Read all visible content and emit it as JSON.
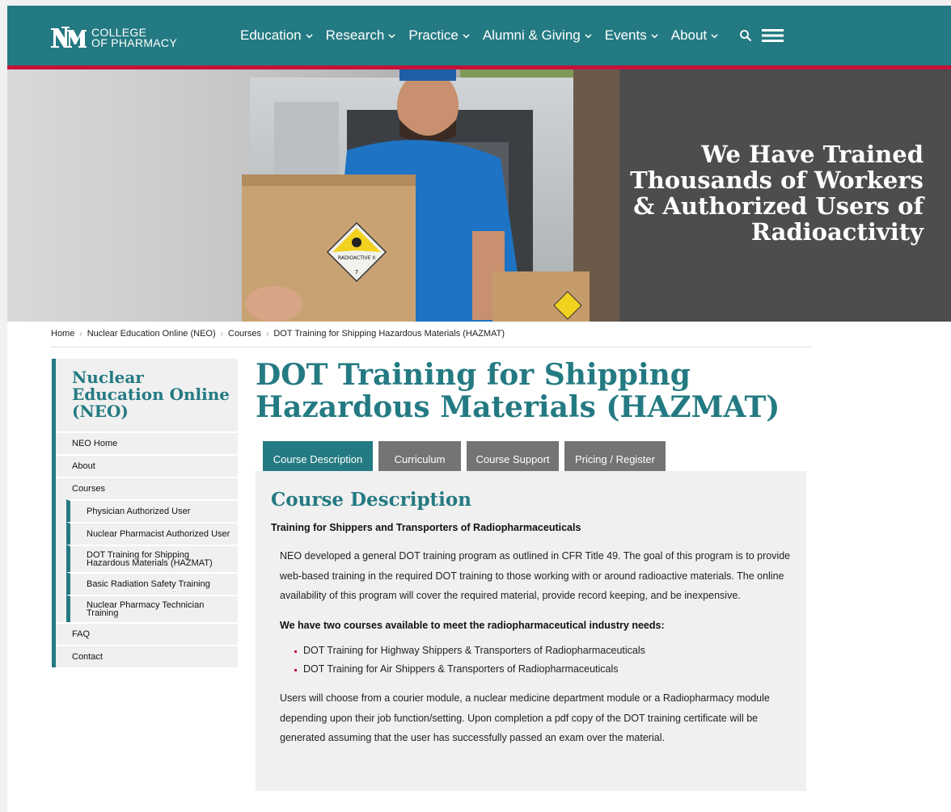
{
  "header": {
    "logo_line1": "COLLEGE",
    "logo_line2": "OF PHARMACY",
    "nav": [
      "Education",
      "Research",
      "Practice",
      "Alumni & Giving",
      "Events",
      "About"
    ]
  },
  "hero": {
    "headline": "We Have Trained Thousands of Workers & Authorized Users of Radioactivity",
    "box_label": "RADIOACTIVE II",
    "box_number": "7"
  },
  "breadcrumb": [
    "Home",
    "Nuclear Education Online (NEO)",
    "Courses",
    "DOT Training for Shipping Hazardous Materials (HAZMAT)"
  ],
  "sidebar": {
    "title": "Nuclear Education Online (NEO)",
    "items": {
      "neo_home": "NEO Home",
      "about": "About",
      "courses": "Courses",
      "physician": "Physician Authorized User",
      "pharmacist": "Nuclear Pharmacist Authorized User",
      "dot_line1": "DOT Training for Shipping",
      "dot_line2": "Hazardous Materials (HAZMAT)",
      "basic_radiation": "Basic Radiation Safety Training",
      "tech_line1": "Nuclear Pharmacy Technician",
      "tech_line2": "Training",
      "faq": "FAQ",
      "contact": "Contact"
    }
  },
  "main": {
    "title": "DOT Training for Shipping Hazardous Materials (HAZMAT)",
    "tabs": [
      "Course Description",
      "Curriculum",
      "Course Support",
      "Pricing / Register"
    ],
    "panel": {
      "heading": "Course Description",
      "subheading": "Training for Shippers and Transporters of Radiopharmaceuticals",
      "paragraph1": "NEO developed a general DOT training program as outlined in CFR Title 49. The goal of this program is to provide web-based training in the required DOT training to those working with or around radioactive materials. The online availability of this program will cover the required material, provide record keeping, and be inexpensive.",
      "needs": "We have two courses available to meet the radiopharmaceutical industry needs:",
      "courses": [
        "DOT Training for Highway Shippers & Transporters of Radiopharmaceuticals",
        "DOT Training for Air Shippers & Transporters of Radiopharmaceuticals"
      ],
      "paragraph2": "Users will choose from a courier module, a nuclear medicine department module or a Radiopharmacy module depending upon their job function/setting. Upon completion a pdf copy of the DOT training certificate will be generated assuming that the user has successfully passed an exam over the material."
    }
  },
  "colors": {
    "teal": "#247a82",
    "red": "#c6123b",
    "gray_tab": "#747474",
    "hero_panel": "#4d4d4d"
  }
}
